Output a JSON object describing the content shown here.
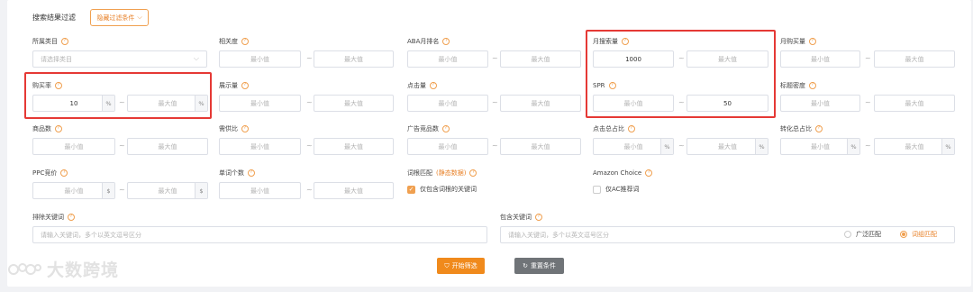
{
  "filter": {
    "title": "搜索结果过滤",
    "hide_button": "隐藏过滤条件"
  },
  "placeholders": {
    "min": "最小值",
    "max": "最大值",
    "category": "请选择类目",
    "keyword": "请输入关键词，多个以英文逗号区分"
  },
  "labels": {
    "category": "所属类目",
    "relevance": "相关度",
    "aba_rank": "ABA月排名",
    "monthly_search": "月搜索量",
    "monthly_purchase": "月购买量",
    "purchase_rate": "购买率",
    "impressions": "展示量",
    "clicks": "点击量",
    "spr": "SPR",
    "title_density": "标题密度",
    "product_count": "商品数",
    "supply_demand": "需供比",
    "ad_product_count": "广告竞品数",
    "click_share": "点击总占比",
    "conversion_share": "转化总占比",
    "ppc_bid": "PPC竞价",
    "word_count": "单词个数",
    "root_match": "词根匹配",
    "root_match_status": "(静态数据)",
    "amazon_choice": "Amazon Choice",
    "exclude_keywords": "排除关键词",
    "include_keywords": "包含关键词"
  },
  "values": {
    "monthly_search_min": "1000",
    "purchase_rate_min": "10",
    "spr_max": "50"
  },
  "units": {
    "percent": "%",
    "dollar": "$"
  },
  "separator": "~",
  "checkboxes": {
    "root_only": "仅包含词根的关键词",
    "ac_only": "仅AC推荐词"
  },
  "radios": {
    "broad": "广泛匹配",
    "phrase": "词组匹配"
  },
  "buttons": {
    "start": "开始筛选",
    "reset": "重置条件"
  },
  "watermark": "大数跨境",
  "colors": {
    "accent": "#f08a1c",
    "highlight": "#e53935",
    "reset": "#707478"
  }
}
